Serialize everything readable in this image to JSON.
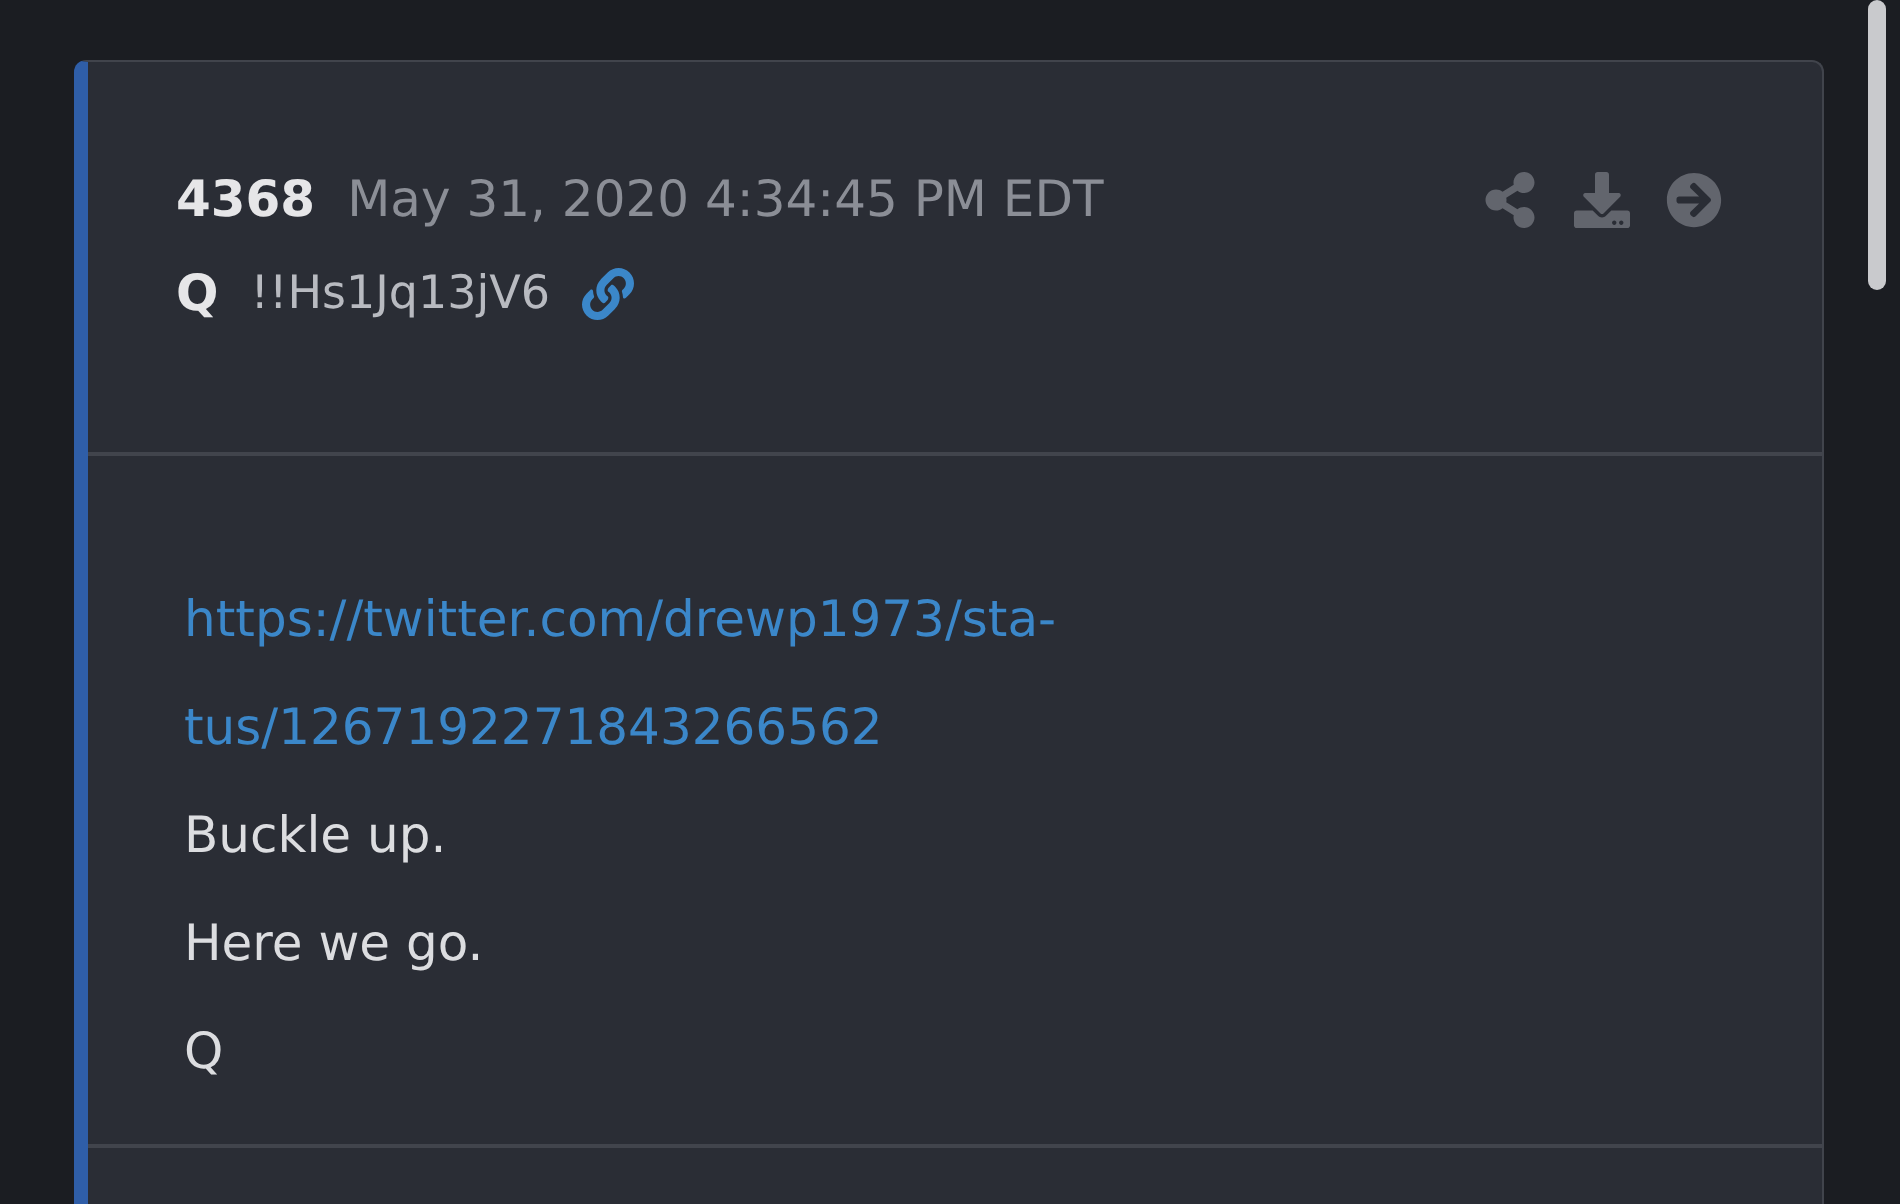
{
  "post": {
    "number": "4368",
    "timestamp": "May 31, 2020 4:34:45 PM EDT",
    "author": "Q",
    "tripcode": "!!Hs1Jq13jV6",
    "link_lines": [
      "https://twitter.com/drewp1973/sta-",
      "tus/1267192271843266562"
    ],
    "lines": [
      "Buckle up.",
      "Here we go.",
      "Q"
    ]
  }
}
